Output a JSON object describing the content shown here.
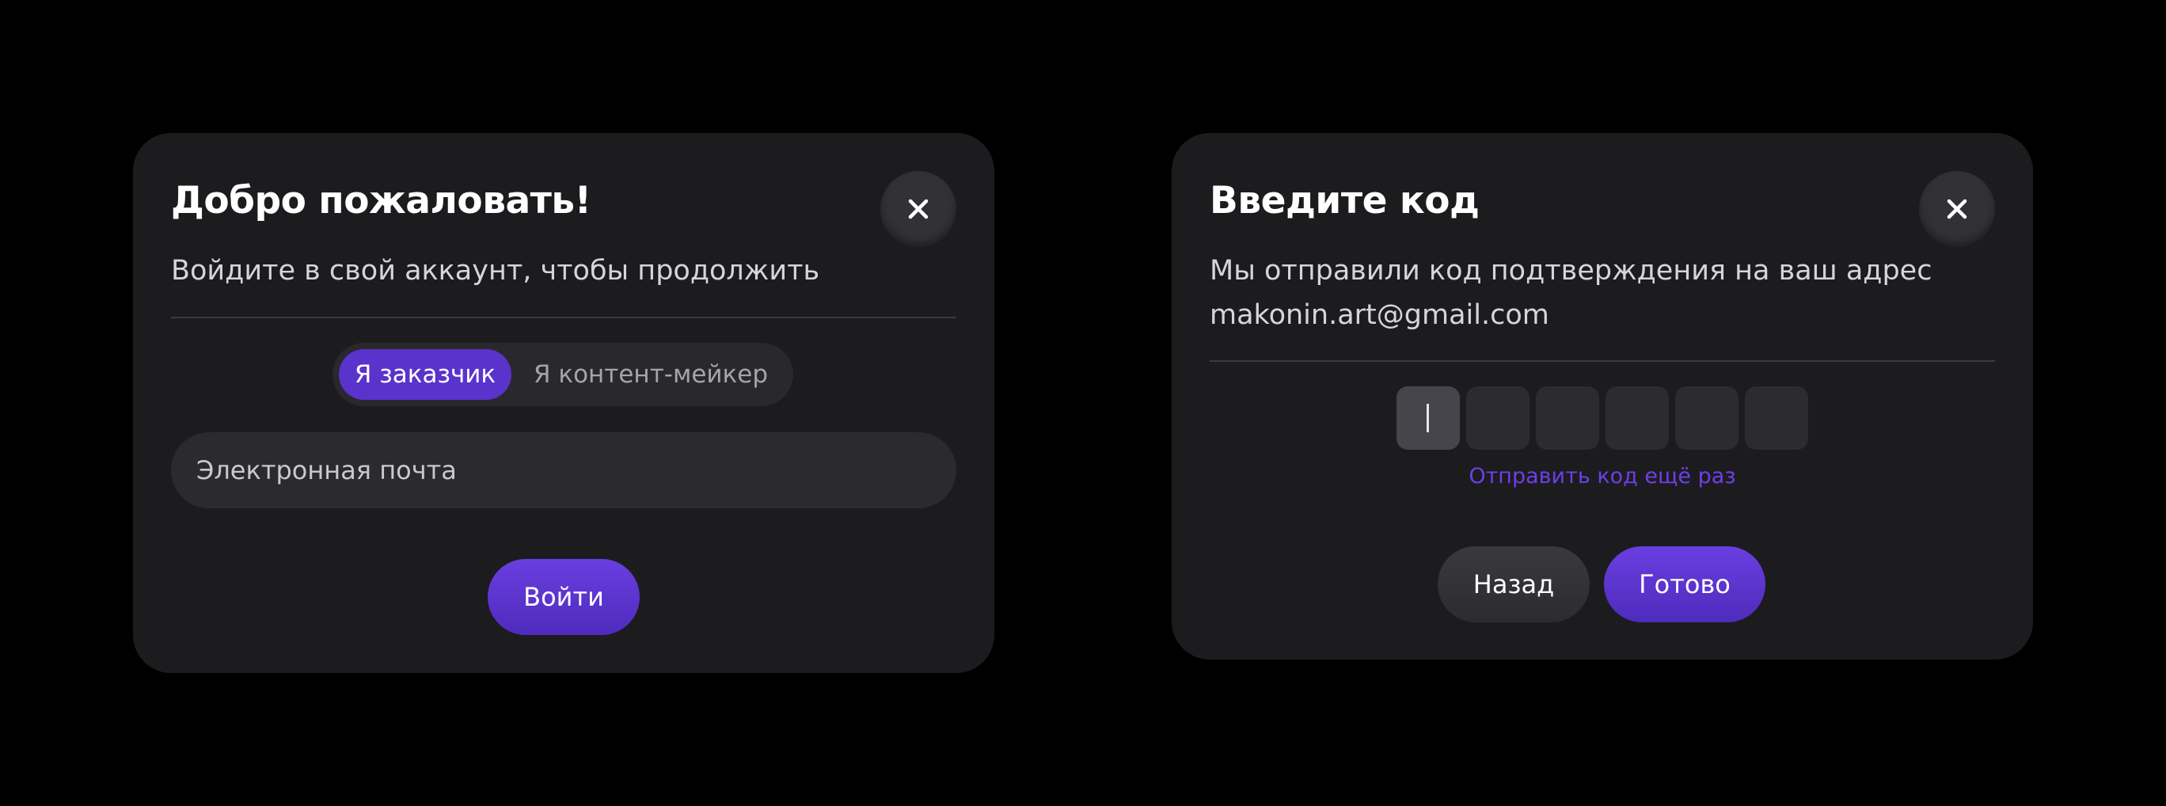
{
  "login_dialog": {
    "title": "Добро пожаловать!",
    "subtitle": "Войдите в свой аккаунт, чтобы продолжить",
    "close_icon": "close-icon",
    "role_toggle": {
      "options": [
        "Я заказчик",
        "Я контент-мейкер"
      ],
      "selected": "Я заказчик"
    },
    "email_input": {
      "placeholder": "Электронная почта",
      "value": ""
    },
    "submit_label": "Войти"
  },
  "code_dialog": {
    "title": "Введите код",
    "subtitle_lines": [
      "Мы отправили код подтверждения на ваш адрес",
      "makonin.art@gmail.com"
    ],
    "close_icon": "close-icon",
    "code_length": 6,
    "code_values": [
      "",
      "",
      "",
      "",
      "",
      ""
    ],
    "active_cell": 1,
    "resend_label": "Отправить код ещё раз",
    "back_label": "Назад",
    "done_label": "Готово"
  },
  "colors": {
    "background": "#000000",
    "card": "#1c1c1f",
    "accent": "#5a32cc",
    "link": "#6d3fe8",
    "field": "#2b2b2f"
  }
}
